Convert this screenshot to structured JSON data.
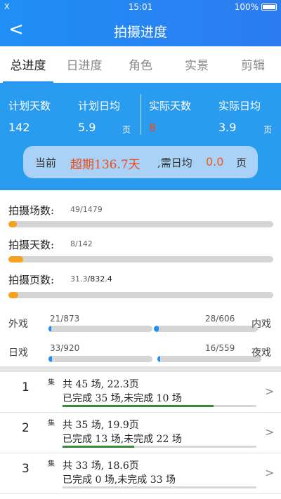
{
  "status_bar": {
    "signal": "X",
    "time": "15:01",
    "battery": "100%"
  },
  "nav": {
    "back": "<",
    "title": "拍摄进度"
  },
  "tabs": [
    {
      "label": "总进度",
      "active": true
    },
    {
      "label": "日进度",
      "active": false
    },
    {
      "label": "角色",
      "active": false
    },
    {
      "label": "实景",
      "active": false
    },
    {
      "label": "剪辑",
      "active": false
    }
  ],
  "summary": {
    "plan_days_label": "计划天数",
    "plan_days": "142",
    "plan_avg_label": "计划日均",
    "plan_avg": "5.9",
    "plan_avg_unit": "页",
    "actual_days_label": "实际天数",
    "actual_days": "8",
    "actual_avg_label": "实际日均",
    "actual_avg": "3.9",
    "actual_avg_unit": "页",
    "current_label": "当前",
    "overdue": "超期136.7天",
    "need_label": ",需日均",
    "need_value": "0.0",
    "need_unit": "页"
  },
  "progress": [
    {
      "label": "拍摄场数:",
      "done": "49",
      "total": "/1479",
      "fraction": 0.033
    },
    {
      "label": "拍摄天数:",
      "done": "8",
      "total": "/142",
      "fraction": 0.056
    },
    {
      "label": "拍摄页数:",
      "done": "31.3",
      "total": "/832.4",
      "fraction": 0.038
    }
  ],
  "scenes": {
    "row1": {
      "left_label": "外戏",
      "left_value": "21/873",
      "left_fraction": 0.024,
      "right_label": "内戏",
      "right_value": "28/606",
      "right_fraction": 0.046
    },
    "row2": {
      "left_label": "日戏",
      "left_value": "33/920",
      "left_fraction": 0.036,
      "right_label": "夜戏",
      "right_value": "16/559",
      "right_fraction": 0.029
    }
  },
  "episodes": [
    {
      "index": "1",
      "ji": "集",
      "line1": "共 45 场, 22.3页",
      "line2": "已完成 35 场,未完成 10 场",
      "fraction": 0.778
    },
    {
      "index": "2",
      "ji": "集",
      "line1": "共 35 场, 19.9页",
      "line2": "已完成 13 场,未完成 22 场",
      "fraction": 0.371
    },
    {
      "index": "3",
      "ji": "集",
      "line1": "共 33 场, 18.6页",
      "line2": "已完成 0 场,未完成 33 场",
      "fraction": 0.0
    }
  ],
  "colors": {
    "primary": "#1f8ff5",
    "summary_bg": "#2a9cf0",
    "progress_orange": "#f6a21e",
    "overdue_red": "#f04a16",
    "episode_green": "#3a8a3a"
  }
}
